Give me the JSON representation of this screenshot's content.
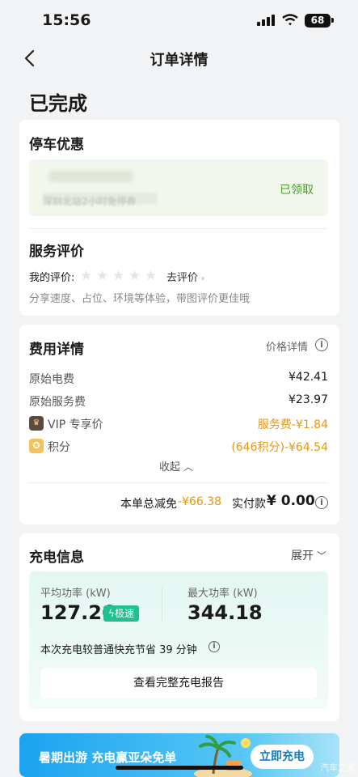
{
  "status_bar": {
    "time": "15:56",
    "battery": "68"
  },
  "header": {
    "title": "订单详情"
  },
  "order_status": "已完成",
  "parking": {
    "title": "停车优惠",
    "coupon_desc": "深圳北站2小时免停券",
    "coupon_status": "已领取"
  },
  "review": {
    "title": "服务评价",
    "my_rating_label": "我的评价:",
    "go_review": "去评价",
    "hint": "分享速度、占位、环境等体验，带图评价更佳哦"
  },
  "fees": {
    "title": "费用详情",
    "price_detail_label": "价格详情",
    "rows": [
      {
        "label": "原始电费",
        "value": "¥42.41"
      },
      {
        "label": "原始服务费",
        "value": "¥23.97"
      }
    ],
    "vip": {
      "label": "VIP 专享价",
      "value": "服务费-¥1.84"
    },
    "points": {
      "label": "积分",
      "value": "(646积分)-¥64.54"
    },
    "collapse_label": "收起",
    "total_discount_label": "本单总减免",
    "total_discount_value": "-¥66.38",
    "paid_label": "实付款",
    "paid_value": "¥ 0.00"
  },
  "charging": {
    "title": "充电信息",
    "expand_label": "展开",
    "avg_power_label": "平均功率 (kW)",
    "avg_power_value": "127.26",
    "speed_badge": "极速",
    "max_power_label": "最大功率 (kW)",
    "max_power_value": "344.18",
    "saving_text": "本次充电较普通快充节省 39 分钟",
    "report_button": "查看完整充电报告"
  },
  "banner": {
    "text": "暑期出游 充电赢亚朵免单",
    "button": "立即充电",
    "watermark": "汽车之家"
  },
  "colors": {
    "accent_green": "#1fc28e",
    "discount_orange": "#e8960b",
    "coupon_green_text": "#4a9a2a",
    "banner_blue": "#1aa3f0"
  }
}
